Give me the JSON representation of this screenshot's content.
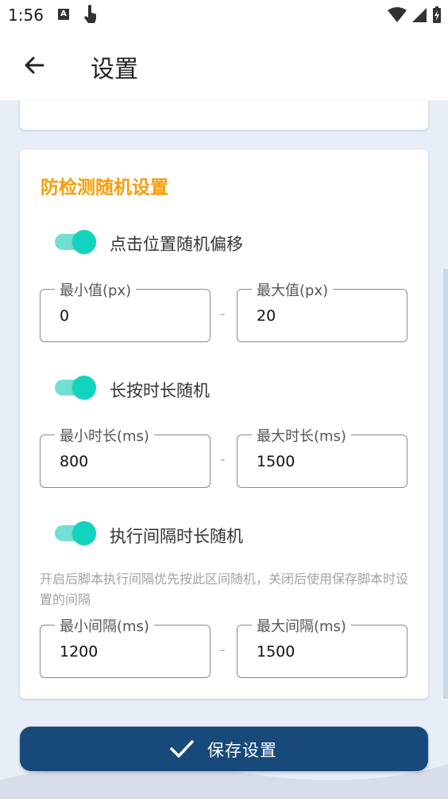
{
  "status_bar": {
    "time": "1:56"
  },
  "app_bar": {
    "title": "设置"
  },
  "section": {
    "title": "防检测随机设置",
    "click_offset": {
      "label": "点击位置随机偏移",
      "enabled": true,
      "min": {
        "label": "最小值(px)",
        "value": "0"
      },
      "max": {
        "label": "最大值(px)",
        "value": "20"
      }
    },
    "long_press": {
      "label": "长按时长随机",
      "enabled": true,
      "min": {
        "label": "最小时长(ms)",
        "value": "800"
      },
      "max": {
        "label": "最大时长(ms)",
        "value": "1500"
      }
    },
    "interval": {
      "label": "执行间隔时长随机",
      "enabled": true,
      "hint": "开启后脚本执行间隔优先按此区间随机，关闭后使用保存脚本时设置的间隔",
      "min": {
        "label": "最小间隔(ms)",
        "value": "1200"
      },
      "max": {
        "label": "最大间隔(ms)",
        "value": "1500"
      }
    },
    "separator": "-"
  },
  "save_button": {
    "label": "保存设置"
  },
  "colors": {
    "accent": "#f59e0b",
    "toggle": "#12d3bd",
    "primary": "#17497a"
  }
}
